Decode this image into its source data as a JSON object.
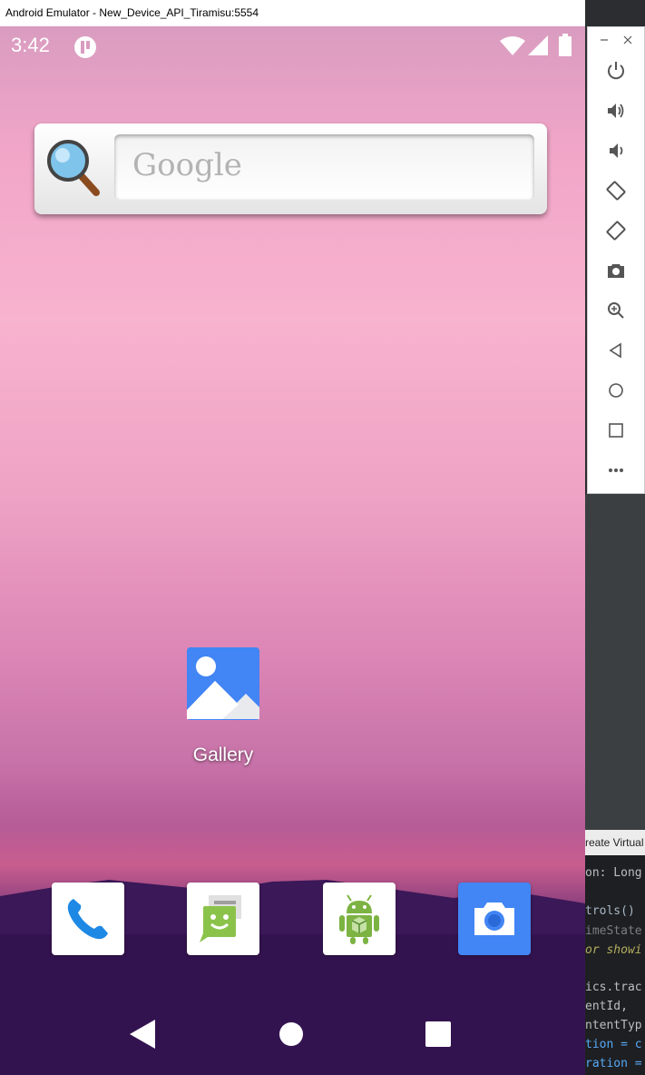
{
  "window": {
    "title": "Android Emulator - New_Device_API_Tiramisu:5554"
  },
  "status_bar": {
    "time": "3:42"
  },
  "search_widget": {
    "placeholder": "Google"
  },
  "home": {
    "apps": [
      {
        "label": "Gallery",
        "icon": "gallery-icon"
      }
    ]
  },
  "dock": {
    "apps": [
      {
        "icon": "phone-icon"
      },
      {
        "icon": "messages-icon"
      },
      {
        "icon": "android-box-icon"
      },
      {
        "icon": "camera-icon"
      }
    ]
  },
  "navigation": {
    "buttons": [
      "back-icon",
      "home-icon",
      "recents-icon"
    ]
  },
  "toolbar": {
    "top": [
      "minimize-icon",
      "close-icon"
    ],
    "buttons": [
      "power-icon",
      "volume-up-icon",
      "volume-down-icon",
      "rotate-left-icon",
      "rotate-right-icon",
      "screenshot-icon",
      "zoom-icon",
      "back-icon",
      "home-icon",
      "overview-icon",
      "more-icon"
    ]
  },
  "ide": {
    "tab_label": "reate Virtual",
    "code_lines": [
      {
        "text": "on: Long",
        "color": "#bcbec4"
      },
      {
        "text": "trols()",
        "color": "#a9b7c6"
      },
      {
        "text": "imeState",
        "color": "#7a7e85"
      },
      {
        "text": "or showi",
        "color": "#b3ae60"
      },
      {
        "text": "ics.trac",
        "color": "#bcbec4"
      },
      {
        "text": "entId,",
        "color": "#bcbec4"
      },
      {
        "text": "ntentTyp",
        "color": "#bcbec4"
      },
      {
        "text": "tion = c",
        "color": "#56a8f5"
      },
      {
        "text": "ration =",
        "color": "#56a8f5"
      }
    ]
  }
}
